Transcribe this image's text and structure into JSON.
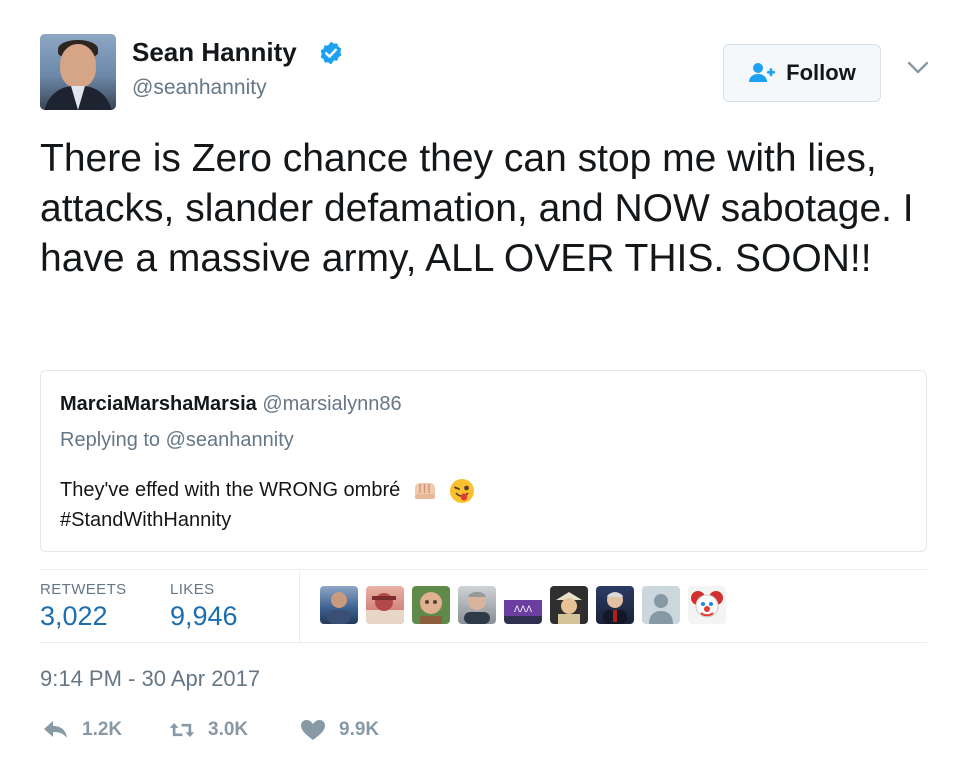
{
  "author": {
    "name": "Sean Hannity",
    "handle": "@seanhannity"
  },
  "follow_button": {
    "label": "Follow"
  },
  "tweet": {
    "text": "There is Zero chance they can stop me with lies, attacks, slander defamation, and NOW sabotage. I have a massive army, ALL OVER THIS. SOON!!",
    "timestamp": "9:14 PM - 30 Apr 2017"
  },
  "quoted_tweet": {
    "name": "MarciaMarshaMarsia",
    "handle": "@marsialynn86",
    "replying_to": "Replying to @seanhannity",
    "line1": "They've effed with the WRONG ombré",
    "line2": "#StandWithHannity"
  },
  "stats": {
    "retweets_label": "RETWEETS",
    "retweets_value": "3,022",
    "likes_label": "LIKES",
    "likes_value": "9,946"
  },
  "actions": {
    "reply_count": "1.2K",
    "retweet_count": "3.0K",
    "like_count": "9.9K"
  },
  "colors": {
    "verified": "#1da1f2",
    "stat_value": "#1b6eb0",
    "muted": "#657786"
  },
  "icons": {
    "verified": "verified-badge-icon",
    "follow": "add-user-icon",
    "menu": "chevron-down-icon",
    "reply": "reply-icon",
    "retweet": "retweet-icon",
    "like": "heart-icon"
  }
}
